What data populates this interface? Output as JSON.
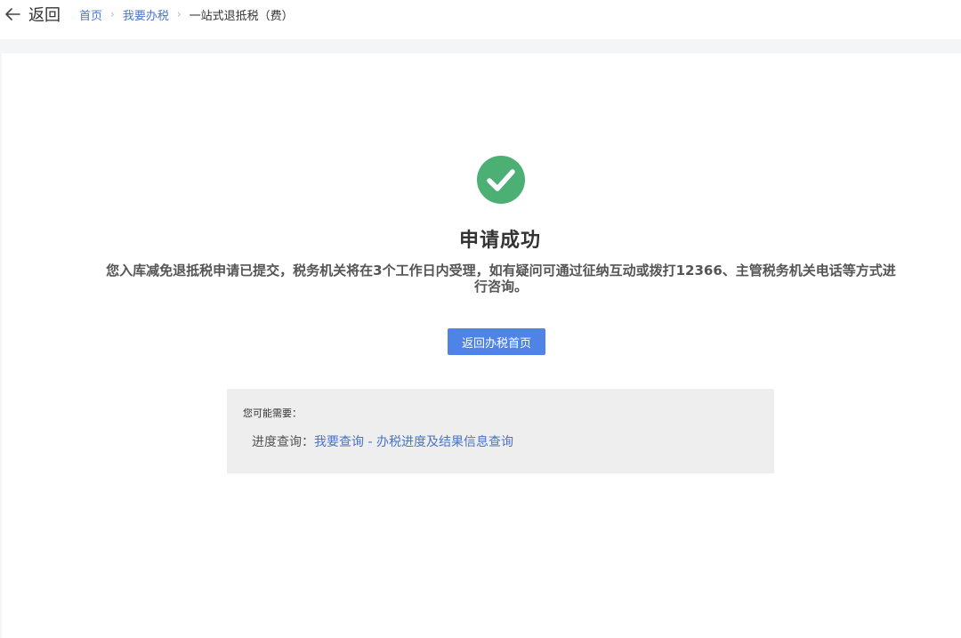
{
  "header": {
    "back_label": "返回",
    "breadcrumb": [
      {
        "label": "首页",
        "link": true
      },
      {
        "label": "我要办税",
        "link": true
      },
      {
        "label": "一站式退抵税（费）",
        "link": false
      }
    ],
    "separator": "›"
  },
  "result": {
    "icon": "check-circle-icon",
    "accent_color": "#4caf73",
    "title": "申请成功",
    "message": "您入库减免退抵税申请已提交，税务机关将在3个工作日内受理，如有疑问可通过征纳互动或拨打12366、主管税务机关电话等方式进行咨询。",
    "button_label": "返回办税首页",
    "button_color": "#4f84e6"
  },
  "suggestions": {
    "title": "您可能需要：",
    "items": [
      {
        "label": "进度查询：",
        "link_text": "我要查询 - 办税进度及结果信息查询"
      }
    ]
  }
}
